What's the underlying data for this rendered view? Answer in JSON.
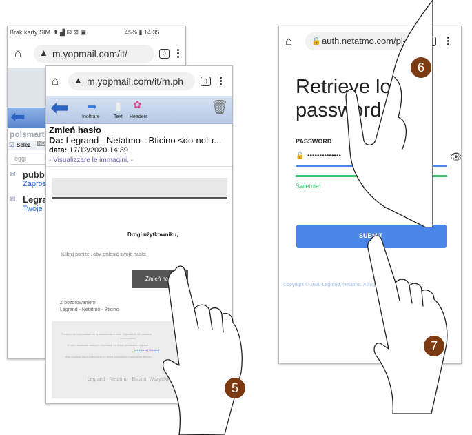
{
  "back_phone": {
    "status_left": "Brak karty SIM",
    "status_right": "45% ▮ 14:35",
    "url": "m.yopmail.com/it/",
    "tab_count": ":)",
    "site_name": "polsmart",
    "select_label": "Selez",
    "select_badge": "NO",
    "search_text": "oggi",
    "items": [
      {
        "title": "pubbl",
        "sub": "Zapros"
      },
      {
        "title": "Legra",
        "sub": "Twoje"
      }
    ]
  },
  "mail_phone": {
    "url": "m.yopmail.com/it/m.ph",
    "tab_count": ":)",
    "toolbar": {
      "forward": "Inoltrare",
      "text": "Text",
      "headers": "Headers"
    },
    "subject": "Zmień hasło",
    "from_label": "Da:",
    "from_value": "Legrand - Netatmo - Bticino <do-not-r...",
    "date_label": "data:",
    "date_value": "17/12/2020 14:39",
    "show_images": "- Visualizzare le immagini. -",
    "greeting": "Drogi użytkowniku,",
    "instruction": "Kliknij poniżej, aby zmienić swoje hasło:",
    "button": "Zmień hasło",
    "signoff_1": "Z pozdrowaniem,",
    "signoff_2": "Legrand - Netatmo - Bticino",
    "footer_1": "Prosimy nie odpowiadać na tę wiadomość e-mail. Odpowiedź nie zostanie",
    "footer_2": "przeczytana",
    "footer_3": "W celu uzyskania dalszych informacji na temat produktów Legrand",
    "footer_link": "technicznej Netatmo",
    "footer_4": "Aby uzyskać więcej informacji na temat produktów Legrand lub Bticino",
    "footer_brand": "Legrand · Netatmo · Bticino. Wszystkie prawa zastrzeżone"
  },
  "reset_phone": {
    "url": "auth.netatmo.com/pl-p",
    "tab_count": ":)",
    "heading_1": "Retrieve lost",
    "heading_2": "password",
    "password_label": "PASSWORD",
    "password_value": "••••••••••••••",
    "strength": "Świetnie!",
    "submit": "SUBMIT",
    "copyright": "Copyright © 2020 Legrand, Netatmo. All rights reserved.",
    "accent_color": "#4a86e8",
    "strength_color": "#3ec46d"
  },
  "steps": [
    "5",
    "6",
    "7"
  ],
  "badge_color": "#7b3a12"
}
